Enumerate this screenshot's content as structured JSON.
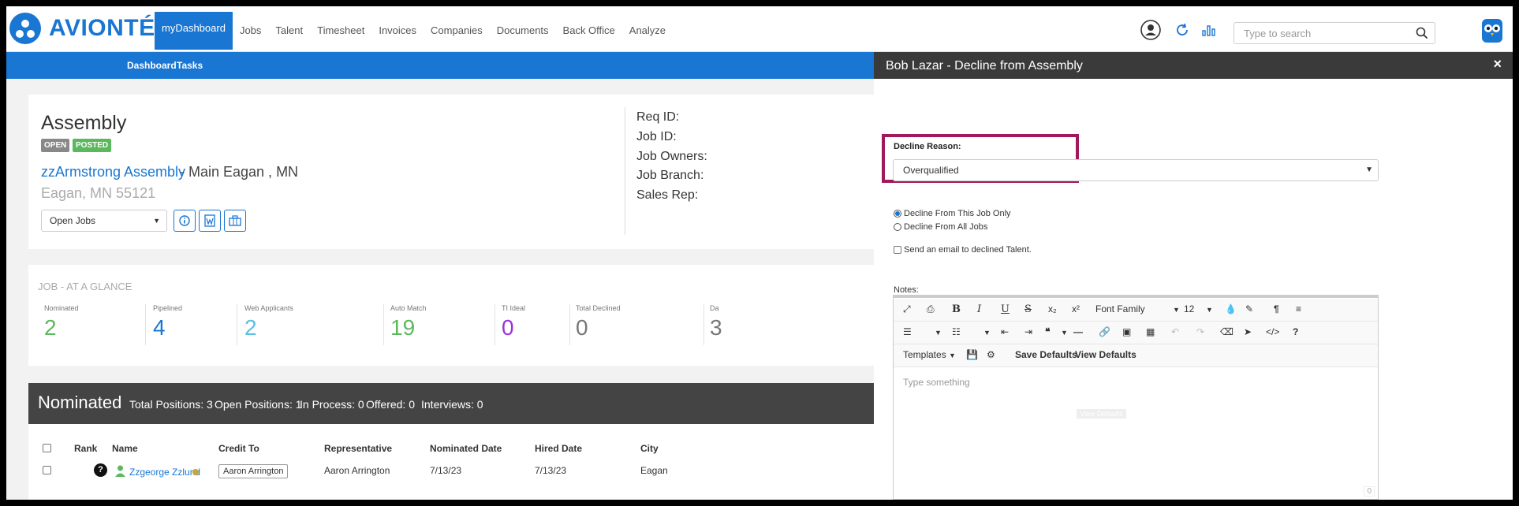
{
  "brand": {
    "name": "AVIONTÉ",
    "accent": "#1976d2"
  },
  "nav": {
    "items": [
      "myDashboard",
      "Jobs",
      "Talent",
      "Timesheet",
      "Invoices",
      "Companies",
      "Documents",
      "Back Office",
      "Analyze"
    ],
    "active": "myDashboard"
  },
  "search": {
    "placeholder": "Type to search"
  },
  "subnav": {
    "items": [
      "Dashboard",
      "Tasks"
    ]
  },
  "job": {
    "title": "Assembly",
    "badges": [
      "OPEN",
      "POSTED"
    ],
    "company": "zzArmstrong Assembly",
    "location": "- Main Eagan , MN",
    "address": "Eagan, MN 55121",
    "jobs_select": "Open Jobs",
    "fields": [
      "Req ID:",
      "Job ID:",
      "Job Owners:",
      "Job Branch:",
      "Sales Rep:"
    ]
  },
  "glance": {
    "title": "JOB - AT A GLANCE",
    "stats": [
      {
        "label": "Nominated",
        "value": "2",
        "color": "#5cb85c"
      },
      {
        "label": "Pipelined",
        "value": "4",
        "color": "#1976d2"
      },
      {
        "label": "Web Applicants",
        "value": "2",
        "color": "#5bc0de"
      },
      {
        "label": "Auto Match",
        "value": "19",
        "color": "#5cb85c"
      },
      {
        "label": "TI Ideal",
        "value": "0",
        "color": "#9b30d9"
      },
      {
        "label": "Total Declined",
        "value": "0",
        "color": "#777"
      },
      {
        "label": "Da",
        "value": "3",
        "color": "#777"
      }
    ]
  },
  "nominated": {
    "title": "Nominated",
    "stats": [
      "Total Positions: 3",
      "Open Positions: 1",
      "In Process: 0",
      "Offered: 0",
      "Interviews: 0"
    ],
    "columns": [
      "Rank",
      "Name",
      "Credit To",
      "Representative",
      "Nominated Date",
      "Hired Date",
      "City"
    ],
    "rows": [
      {
        "rank": "?",
        "name": "Zzgeorge Zzlund",
        "credit_to": "Aaron Arrington",
        "representative": "Aaron Arrington",
        "nominated_date": "7/13/23",
        "hired_date": "7/13/23",
        "city": "Eagan"
      }
    ]
  },
  "panel": {
    "title": "Bob Lazar - Decline from Assembly",
    "close": "×",
    "decline_label": "Decline Reason:",
    "decline_value": "Overqualified",
    "radio1": "Decline From This Job Only",
    "radio2": "Decline From All Jobs",
    "email_check": "Send an email to declined Talent.",
    "notes_label": "Notes:",
    "font_family": "Font Family",
    "font_size": "12",
    "templates": "Templates",
    "save_defaults": "Save Defaults",
    "view_defaults": "View Defaults",
    "tooltip": "View Defaults",
    "placeholder": "Type something",
    "counter": "0"
  }
}
